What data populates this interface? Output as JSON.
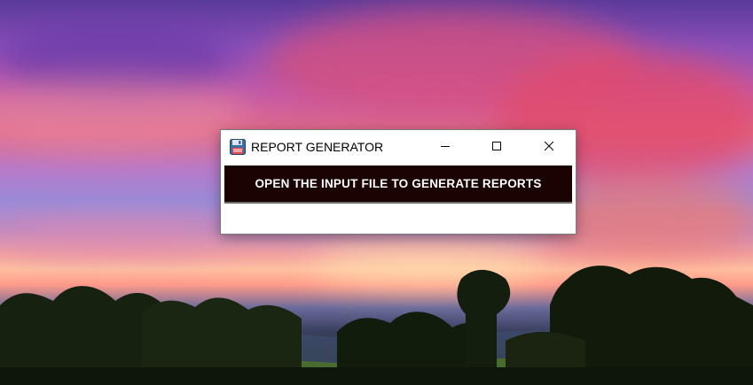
{
  "window": {
    "title": "REPORT GENERATOR",
    "app_icon": "floppy-disk-icon",
    "controls": {
      "minimize_icon": "minimize-icon",
      "maximize_icon": "maximize-icon",
      "close_icon": "close-icon"
    }
  },
  "main": {
    "open_button_label": "OPEN THE INPUT FILE TO GENERATE REPORTS"
  },
  "colors": {
    "button_bg": "#1b0303",
    "button_text": "#ffffff",
    "window_bg": "#ffffff"
  }
}
